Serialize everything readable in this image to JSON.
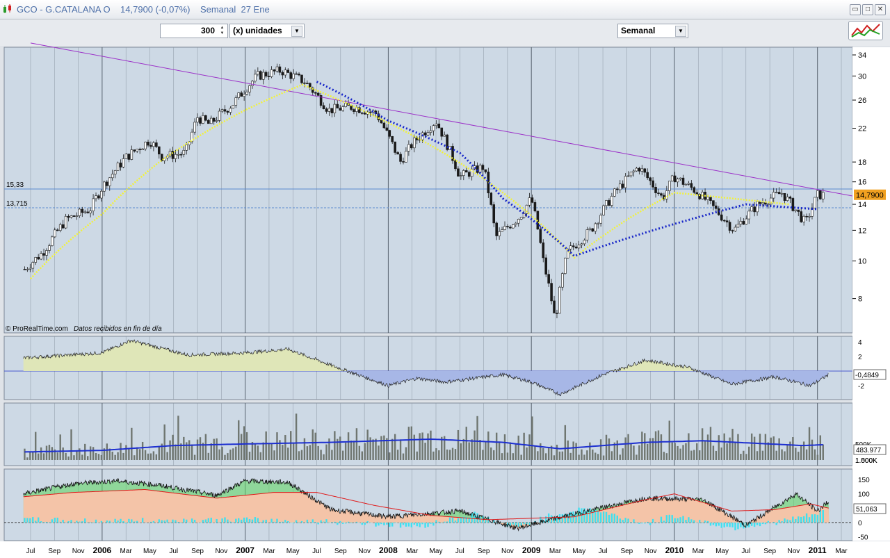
{
  "window": {
    "title": "GCO - G.CATALANA O    14,7900 (-0,07%)    Semanal  27 Ene",
    "minimize_symbol": "▭",
    "maximize_symbol": "□",
    "close_symbol": "✕"
  },
  "toolbar": {
    "quantity_value": "300",
    "units_label": "(x) unidades",
    "period_label": "Semanal",
    "spin_up_symbol": "▲",
    "spin_down_symbol": "▼",
    "dropdown_symbol": "▼"
  },
  "icons": [
    "app-candles-icon",
    "chart-settings-icon",
    "spin-up-icon",
    "spin-down-icon",
    "dropdown-arrow-icon"
  ],
  "colors": {
    "panel_bg": "#cdd9e5",
    "grid": "#8b96a3",
    "trendline": "#9b30c8",
    "ma_yellow": "#f2f23a",
    "ma_blue_dots": "#1826c8",
    "last_price_box": "#f0a020",
    "osc_pos_fill": "#dfe6b8",
    "osc_neg_fill": "#a7b7e6",
    "volume_bar": "#6f7670",
    "volume_ma": "#1d2fd0",
    "dmi_salmon": "#f4c4a8",
    "dmi_cyan": "#3fe0f0",
    "dmi_green": "#5cd65c",
    "dmi_red": "#e01818"
  },
  "price_panel": {
    "y_ticks": [
      "34",
      "30",
      "26",
      "22",
      "18",
      "16",
      "14",
      "12",
      "10",
      "8"
    ],
    "level_high_label": "15,33",
    "level_low_label": "13,715",
    "last_price_label": "14,7900",
    "watermark": "© ProRealTime.com",
    "data_note": "Datos recibidos en fin de día"
  },
  "oscillator_panel": {
    "y_ticks": [
      "4",
      "2",
      "-2"
    ],
    "last_value_label": "-0,4849"
  },
  "volume_panel": {
    "y_ticks": [
      "1.500K",
      "1.000K",
      "500K"
    ],
    "last_value_label": "483.977"
  },
  "dmi_panel": {
    "y_ticks": [
      "150",
      "100",
      "50",
      "0",
      "-50"
    ],
    "last_value_label": "51,063"
  },
  "x_axis": {
    "labels": [
      "Jul",
      "Sep",
      "Nov",
      "2006",
      "Mar",
      "May",
      "Jul",
      "Sep",
      "Nov",
      "2007",
      "Mar",
      "May",
      "Jul",
      "Sep",
      "Nov",
      "2008",
      "Mar",
      "May",
      "Jul",
      "Sep",
      "Nov",
      "2009",
      "Mar",
      "May",
      "Jul",
      "Sep",
      "Nov",
      "2010",
      "Mar",
      "May",
      "Jul",
      "Sep",
      "Nov",
      "2011",
      "Mar"
    ],
    "year_labels": [
      "2006",
      "2007",
      "2008",
      "2009",
      "2010",
      "2011"
    ]
  },
  "chart_data": {
    "type": "candlestick",
    "ylim": [
      7,
      35
    ],
    "price_key_points": [
      [
        "2005-06",
        9.2
      ],
      [
        "2005-08",
        10.5
      ],
      [
        "2005-10",
        12.8
      ],
      [
        "2005-12",
        13.6
      ],
      [
        "2006-01",
        15.5
      ],
      [
        "2006-03",
        18.5
      ],
      [
        "2006-05",
        20.5
      ],
      [
        "2006-06",
        18.6
      ],
      [
        "2006-08",
        19.0
      ],
      [
        "2006-09",
        23.5
      ],
      [
        "2006-10",
        22.5
      ],
      [
        "2006-12",
        25.5
      ],
      [
        "2007-02",
        30.0
      ],
      [
        "2007-04",
        31.0
      ],
      [
        "2007-06",
        29.0
      ],
      [
        "2007-08",
        24.5
      ],
      [
        "2007-10",
        25.0
      ],
      [
        "2007-12",
        24.0
      ],
      [
        "2008-01",
        21.0
      ],
      [
        "2008-02",
        18.0
      ],
      [
        "2008-03",
        20.0
      ],
      [
        "2008-05",
        23.0
      ],
      [
        "2008-07",
        16.5
      ],
      [
        "2008-09",
        17.5
      ],
      [
        "2008-10",
        11.5
      ],
      [
        "2008-12",
        13.0
      ],
      [
        "2009-01",
        14.5
      ],
      [
        "2009-02",
        10.0
      ],
      [
        "2009-03",
        7.0
      ],
      [
        "2009-04",
        10.5
      ],
      [
        "2009-06",
        12.0
      ],
      [
        "2009-08",
        15.0
      ],
      [
        "2009-10",
        17.5
      ],
      [
        "2009-12",
        14.5
      ],
      [
        "2010-01",
        16.5
      ],
      [
        "2010-03",
        15.0
      ],
      [
        "2010-05",
        13.0
      ],
      [
        "2010-06",
        12.0
      ],
      [
        "2010-08",
        14.0
      ],
      [
        "2010-10",
        15.0
      ],
      [
        "2010-12",
        12.5
      ],
      [
        "2011-01",
        14.8
      ]
    ],
    "moving_average_yellow": [
      [
        2005.5,
        9.0
      ],
      [
        2006.0,
        13.2
      ],
      [
        2006.4,
        18.0
      ],
      [
        2007.0,
        24.5
      ],
      [
        2007.4,
        28.5
      ],
      [
        2009.3,
        10.2
      ],
      [
        2009.7,
        13.0
      ],
      [
        2010.0,
        15.0
      ],
      [
        2010.8,
        14.0
      ]
    ],
    "moving_average_blue": [
      [
        2007.5,
        29.0
      ],
      [
        2008.0,
        23.0
      ],
      [
        2008.5,
        19.0
      ],
      [
        2008.8,
        14.5
      ],
      [
        2009.3,
        10.3
      ],
      [
        2010.5,
        14.0
      ],
      [
        2011.0,
        13.6
      ]
    ],
    "trendline": [
      [
        2005.5,
        36.5
      ],
      [
        2011.3,
        14.5
      ]
    ],
    "horizontal_levels": [
      15.33,
      13.715
    ],
    "last_price": 14.79,
    "oscillator_last": -0.4849,
    "volume_last": 483977,
    "dmi_last": 51.063
  }
}
